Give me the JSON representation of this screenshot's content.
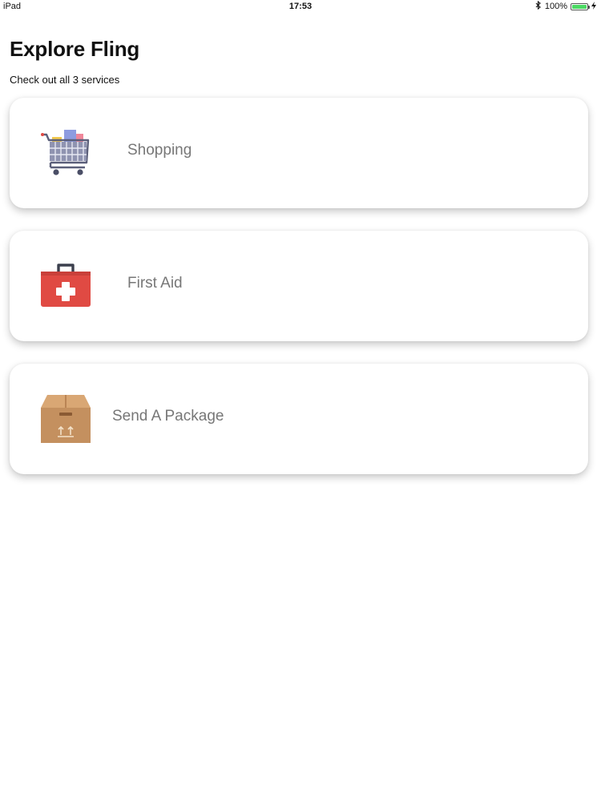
{
  "status_bar": {
    "device": "iPad",
    "time": "17:53",
    "bluetooth_icon": "bluetooth-icon",
    "battery_percent_label": "100%",
    "battery_level": 1.0
  },
  "header": {
    "title": "Explore Fling",
    "subtitle": "Check out all 3 services"
  },
  "services": [
    {
      "label": "Shopping",
      "icon": "shopping-cart-icon"
    },
    {
      "label": "First Aid",
      "icon": "first-aid-kit-icon"
    },
    {
      "label": "Send A Package",
      "icon": "package-box-icon"
    }
  ],
  "colors": {
    "first_aid_red": "#e04a43",
    "package_brown": "#c4905f",
    "cart_frame": "#5b5f7a",
    "battery_green": "#4cd964"
  }
}
